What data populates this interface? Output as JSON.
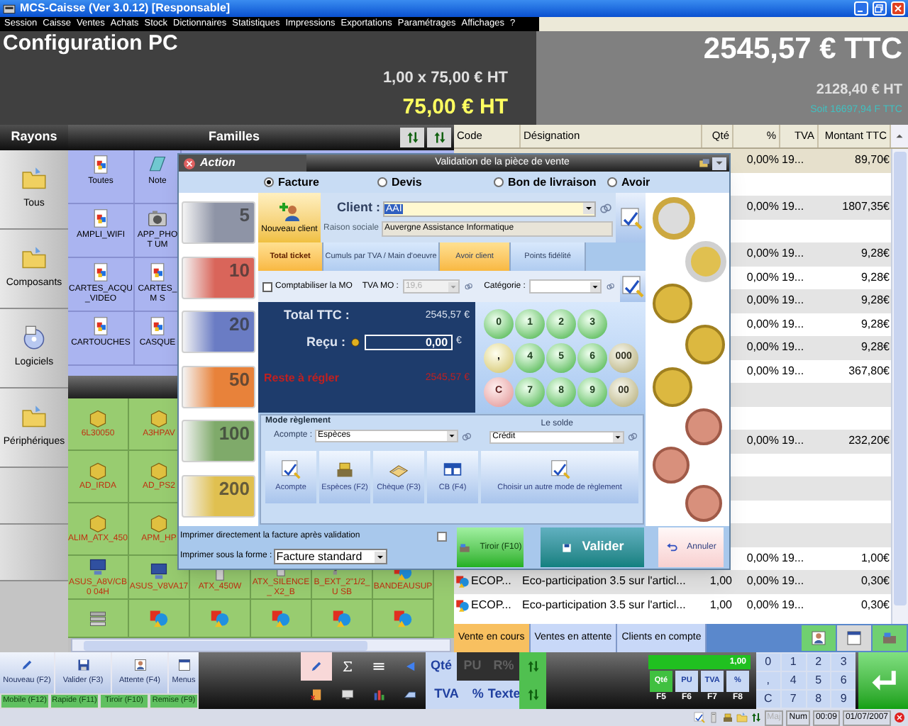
{
  "window": {
    "title": "MCS-Caisse (Ver 3.0.12) [Responsable]"
  },
  "menu": [
    "Session",
    "Caisse",
    "Ventes",
    "Achats",
    "Stock",
    "Dictionnaires",
    "Statistiques",
    "Impressions",
    "Exportations",
    "Paramétrages",
    "Affichages",
    "?"
  ],
  "header": {
    "article": "Configuration PC",
    "quantity_price": "1,00 x 75,00 € HT",
    "line_total": "75,00 € HT",
    "total_ttc": "2545,57 € TTC",
    "total_ht": "2128,40 € HT",
    "total_francs": "Soit 16697,94 F TTC"
  },
  "rayons": {
    "title": "Rayons",
    "items": [
      {
        "label": "Tous",
        "kind": "folder"
      },
      {
        "label": "Composants",
        "kind": "folder"
      },
      {
        "label": "Logiciels",
        "kind": "disc"
      },
      {
        "label": "Périphériques",
        "kind": "folder"
      }
    ]
  },
  "familles": {
    "title": "Familles",
    "items": [
      {
        "label": "Toutes",
        "kind": "doc"
      },
      {
        "label": "Note",
        "kind": "notebook"
      },
      {
        "label": "AMPLI_WIFI",
        "kind": "doc"
      },
      {
        "label": "APP_PHOT UM",
        "kind": "camera"
      },
      {
        "label": "CARTES_ACQU _VIDEO",
        "kind": "doc"
      },
      {
        "label": "CARTES_M S",
        "kind": "doc"
      },
      {
        "label": "CARTOUCHES",
        "kind": "doc"
      },
      {
        "label": "CASQUE",
        "kind": "doc"
      }
    ]
  },
  "products": [
    [
      {
        "label": "6L30050",
        "kind": "box"
      },
      {
        "label": "A3HPAV",
        "kind": "box"
      }
    ],
    [
      {
        "label": "AD_IRDA",
        "kind": "box"
      },
      {
        "label": "AD_PS2",
        "kind": "box"
      }
    ],
    [
      {
        "label": "ALIM_ATX_450",
        "kind": "box"
      },
      {
        "label": "APM_HP",
        "kind": "box"
      }
    ],
    [
      {
        "label": "ASUS_A8V/CB0 04H",
        "kind": "pc"
      },
      {
        "label": "ASUS_V8VA17",
        "kind": "pc"
      },
      {
        "label": "ATX_450W",
        "kind": "tower"
      },
      {
        "label": "ATX_SILENCE_ X2_B",
        "kind": "tower"
      },
      {
        "label": "B_EXT_2\"1/2_U SB",
        "kind": "cable"
      },
      {
        "label": "BANDEAUSUP",
        "kind": "shapes"
      }
    ],
    [
      {
        "kind": "stack"
      },
      {
        "kind": "shapes"
      },
      {
        "kind": "shapes"
      },
      {
        "kind": "shapes"
      },
      {
        "kind": "shapes"
      },
      {
        "kind": "shapes"
      }
    ]
  ],
  "table": {
    "columns": [
      "Code",
      "Désignation",
      "Qté",
      "%",
      "TVA",
      "Montant TTC"
    ],
    "rows": [
      {
        "kind": "item",
        "selected": true,
        "pct": "0,00%",
        "tva": "19...",
        "amount": "89,70€"
      },
      {
        "kind": "blank",
        "selected": false
      },
      {
        "kind": "item",
        "selected": false,
        "pct": "0,00%",
        "tva": "19...",
        "amount": "1807,35€"
      },
      {
        "kind": "blank",
        "selected": false
      },
      {
        "kind": "item",
        "selected": false,
        "pct": "0,00%",
        "tva": "19...",
        "amount": "9,28€"
      },
      {
        "kind": "item",
        "selected": false,
        "pct": "0,00%",
        "tva": "19...",
        "amount": "9,28€"
      },
      {
        "kind": "item",
        "selected": false,
        "pct": "0,00%",
        "tva": "19...",
        "amount": "9,28€"
      },
      {
        "kind": "item",
        "selected": false,
        "pct": "0,00%",
        "tva": "19...",
        "amount": "9,28€"
      },
      {
        "kind": "item",
        "selected": false,
        "pct": "0,00%",
        "tva": "19...",
        "amount": "9,28€"
      },
      {
        "kind": "item",
        "selected": false,
        "pct": "0,00%",
        "tva": "19...",
        "amount": "367,80€"
      },
      {
        "kind": "blank",
        "selected": false
      },
      {
        "kind": "blank",
        "selected": false
      },
      {
        "kind": "item",
        "selected": false,
        "pct": "0,00%",
        "tva": "19...",
        "amount": "232,20€"
      },
      {
        "kind": "blank",
        "selected": false
      },
      {
        "kind": "blank",
        "selected": false
      },
      {
        "kind": "blank",
        "selected": false
      },
      {
        "kind": "blank",
        "selected": false
      },
      {
        "kind": "item",
        "selected": false,
        "pct": "0,00%",
        "tva": "19...",
        "amount": "1,00€"
      },
      {
        "kind": "item",
        "selected": false,
        "code": "ECOP...",
        "designation": "Eco-participation 3.5 sur l'articl...",
        "qty": "1,00",
        "pct": "0,00%",
        "tva": "19...",
        "amount": "0,30€"
      },
      {
        "kind": "item",
        "selected": false,
        "code": "ECOP...",
        "designation": "Eco-participation 3.5 sur l'articl...",
        "qty": "1,00",
        "pct": "0,00%",
        "tva": "19...",
        "amount": "0,30€"
      }
    ]
  },
  "sale_tabs": [
    {
      "label": "Vente en cours",
      "selected": true
    },
    {
      "label": "Ventes en attente",
      "selected": false
    },
    {
      "label": "Clients en compte",
      "selected": false
    }
  ],
  "toolbar": {
    "main_buttons": [
      {
        "label": "Nouveau (F2)",
        "kind": "pencil"
      },
      {
        "label": "Valider (F3)",
        "kind": "save"
      },
      {
        "label": "Attente (F4)",
        "kind": "person"
      },
      {
        "label": "Menus",
        "kind": "menu"
      }
    ],
    "quick_buttons": [
      "Mobile (F12)",
      "Rapide (F11)",
      "Tiroir (F10)",
      "Remise (F9)"
    ],
    "edit_tools": [
      {
        "kind": "pencil",
        "selected": true
      },
      {
        "kind": "sigma",
        "selected": false
      },
      {
        "kind": "lines",
        "selected": false
      },
      {
        "kind": "back",
        "selected": false
      },
      {
        "kind": "delete",
        "selected": false
      },
      {
        "kind": "monitor",
        "selected": false
      },
      {
        "kind": "chart",
        "selected": false
      },
      {
        "kind": "scanner",
        "selected": false
      }
    ],
    "field_buttons": [
      {
        "label": "Qté",
        "disabled": false
      },
      {
        "label": "PU",
        "disabled": true
      },
      {
        "label": "R%",
        "disabled": true
      },
      {
        "label": "TVA",
        "disabled": false
      },
      {
        "label": "%",
        "disabled": false
      },
      {
        "label": "Texte",
        "disabled": false
      }
    ],
    "display": "1,00",
    "modes": [
      {
        "label": "Qté",
        "fkey": "F5",
        "selected": true
      },
      {
        "label": "PU",
        "fkey": "F6",
        "selected": false
      },
      {
        "label": "TVA",
        "fkey": "F7",
        "selected": false
      },
      {
        "label": "%",
        "fkey": "F8",
        "selected": false
      }
    ],
    "numpad": [
      "0",
      "1",
      "2",
      "3",
      ",",
      "4",
      "5",
      "6",
      "C",
      "7",
      "8",
      "9"
    ]
  },
  "status_bar": {
    "caps": "Maj",
    "caps_on": false,
    "num": "Num",
    "time": "00:09",
    "date": "01/07/2007"
  },
  "dialog": {
    "action_tab": "Action",
    "title": "Validation de la pièce de vente",
    "doc_types": [
      {
        "label": "Facture",
        "selected": true
      },
      {
        "label": "Devis",
        "selected": false
      },
      {
        "label": "Bon de livraison",
        "selected": false
      },
      {
        "label": "Avoir",
        "selected": false
      }
    ],
    "banknotes": [
      {
        "value": "5",
        "color": "#8e94a6"
      },
      {
        "value": "10",
        "color": "#d9655a"
      },
      {
        "value": "20",
        "color": "#6a7cc4"
      },
      {
        "value": "50",
        "color": "#e8823a"
      },
      {
        "value": "100",
        "color": "#7faa6a"
      },
      {
        "value": "200",
        "color": "#e0c050"
      }
    ],
    "new_client_button": "Nouveau client",
    "client": {
      "label": "Client :",
      "value": "AAI"
    },
    "company": {
      "label": "Raison sociale",
      "value": "Auvergne Assistance Informatique"
    },
    "tabs": [
      {
        "label": "Total ticket",
        "selected": true,
        "highlighted": true
      },
      {
        "label": "Cumuls par TVA / Main d'oeuvre",
        "selected": false,
        "highlighted": false
      },
      {
        "label": "Avoir client",
        "selected": false,
        "highlighted": true
      },
      {
        "label": "Points fidélité",
        "selected": false,
        "highlighted": false
      }
    ],
    "labour": {
      "label": "Comptabiliser la MO",
      "checked": false
    },
    "vat": {
      "label": "TVA MO :",
      "value": "19,6",
      "disabled": true
    },
    "category": {
      "label": "Catégorie :"
    },
    "totals": {
      "total_label": "Total TTC :",
      "total_value": "2545,57 €",
      "received_label": "Reçu :",
      "received_value": "0,00",
      "currency": "€",
      "remaining_label": "Reste à régler",
      "remaining_value": "2545,57 €"
    },
    "keypad": [
      [
        {
          "key": "0",
          "kind": "digit"
        },
        {
          "key": "1",
          "kind": "digit"
        },
        {
          "key": "2",
          "kind": "digit"
        },
        {
          "key": "3",
          "kind": "digit"
        }
      ],
      [
        {
          "key": ",",
          "kind": "decimal"
        },
        {
          "key": "4",
          "kind": "digit"
        },
        {
          "key": "5",
          "kind": "digit"
        },
        {
          "key": "6",
          "kind": "digit"
        },
        {
          "key": "000",
          "kind": "multi"
        }
      ],
      [
        {
          "key": "C",
          "kind": "clear"
        },
        {
          "key": "7",
          "kind": "digit"
        },
        {
          "key": "8",
          "kind": "digit"
        },
        {
          "key": "9",
          "kind": "digit"
        },
        {
          "key": "00",
          "kind": "multi"
        }
      ]
    ],
    "coins": [
      {
        "kind": "silver-core"
      },
      {
        "kind": "gold-core"
      },
      {
        "kind": "gold"
      },
      {
        "kind": "gold"
      },
      {
        "kind": "gold"
      },
      {
        "kind": "copper"
      },
      {
        "kind": "copper"
      },
      {
        "kind": "copper"
      }
    ],
    "payment": {
      "title": "Mode règlement",
      "deposit_label": "Acompte :",
      "deposit_value": "Espèces",
      "balance_label": "Le solde",
      "balance_value": "Crédit",
      "buttons": [
        {
          "label": "Acompte",
          "kind": "abc"
        },
        {
          "label": "Espèces (F2)",
          "kind": "cash"
        },
        {
          "label": "Chèque (F3)",
          "kind": "cheque"
        },
        {
          "label": "CB (F4)",
          "kind": "card"
        },
        {
          "label": "Choisir un autre mode de règlement",
          "kind": "abc"
        }
      ]
    },
    "print": {
      "direct_label": "Imprimer directement la facture après validation",
      "direct_checked": false,
      "format_label": "Imprimer sous la forme :",
      "format_value": "Facture standard"
    },
    "actions": [
      {
        "label": "Tiroir (F10)",
        "kind": "drawer"
      },
      {
        "label": "Valider",
        "kind": "validate"
      },
      {
        "label": "Annuler",
        "kind": "cancel"
      }
    ]
  }
}
